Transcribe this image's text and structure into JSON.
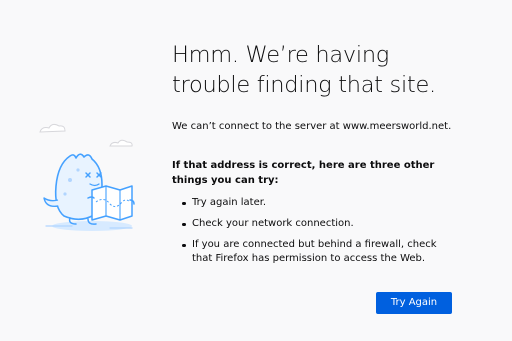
{
  "error_page": {
    "title": "Hmm. We’re having trouble finding that site.",
    "description": "We can’t connect to the server at www.meersworld.net.",
    "subheading": "If that address is correct, here are three other things you can try:",
    "tips": [
      {
        "text": "Try again later."
      },
      {
        "text": "Check your network connection."
      },
      {
        "text": "If you are connected but behind a firewall, check that Firefox has permission to access the Web."
      }
    ],
    "try_again_label": "Try Again",
    "illustration": "confused-dino-with-map-illustration"
  },
  "colors": {
    "background": "#f9f9fa",
    "accent": "#0060df",
    "text": "#0c0c0d",
    "illustration_blue": "#45a1ff"
  }
}
